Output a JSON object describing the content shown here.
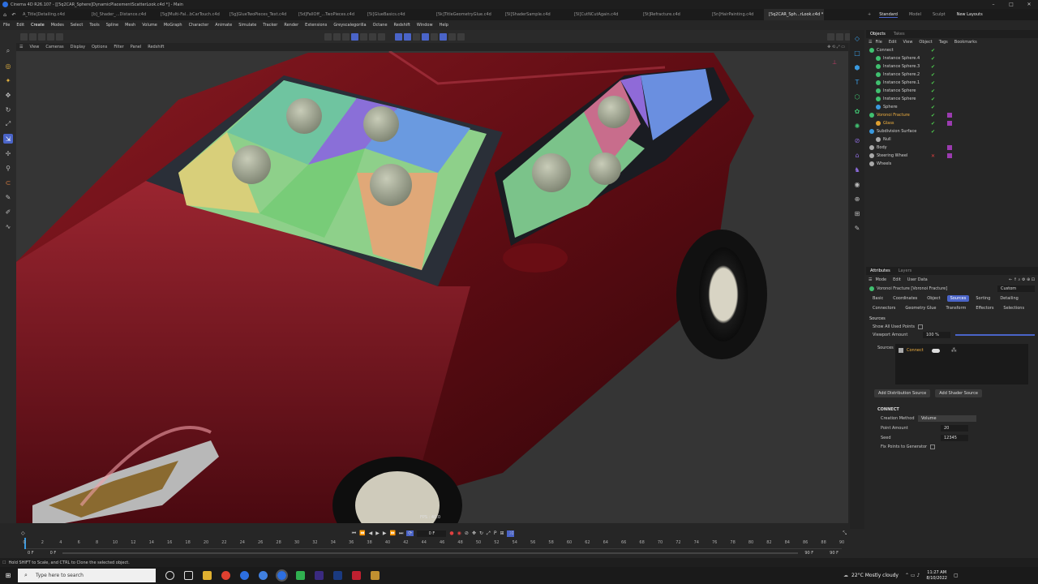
{
  "window": {
    "title": "Cinema 4D R26.107 - [[5q2CAR_Sphere]DynamicPlacementScatterLook.c4d *] - Main",
    "controls": [
      "–",
      "□",
      "✕"
    ]
  },
  "doc_tabs": [
    "A_Title]Detailing.c4d",
    "[b]_Shader_...Distance.c4d",
    "[5g]Multi-Fal...bCarTouch.c4d",
    "[5g]GlueTwoPieces_Text.c4d",
    "[5d]FallOff_...TwoPieces.c4d",
    "[5i]GlueBasics.c4d",
    "[5k]TitleGeometryGlue.c4d",
    "[5l]ShaderSample.c4d",
    "[5l]CutNCutAgain.c4d",
    "[5t]Refracture.c4d",
    "[5n]HairPainting.c4d",
    "[5q2CAR_Sph...rLook.c4d *"
  ],
  "layouts": {
    "standard": "Standard",
    "model": "Model",
    "sculpt": "Sculpt",
    "new_layouts": "New Layouts"
  },
  "menubar": [
    "File",
    "Edit",
    "Create",
    "Modes",
    "Select",
    "Tools",
    "Spline",
    "Mesh",
    "Volume",
    "MoGraph",
    "Character",
    "Animate",
    "Simulate",
    "Tracker",
    "Render",
    "Extensions",
    "Greyscalegorilla",
    "Octane",
    "Redshift",
    "Window",
    "Help"
  ],
  "view_menu": [
    "View",
    "Cameras",
    "Display",
    "Options",
    "Filter",
    "Panel",
    "Redshift"
  ],
  "viewport": {
    "fps": "FPS : 40.0"
  },
  "objects_panel": {
    "tabs": [
      "Objects",
      "Takes"
    ],
    "menu": [
      "File",
      "Edit",
      "View",
      "Object",
      "Tags",
      "Bookmarks"
    ],
    "items": [
      "Connect",
      "Instance Sphere.4",
      "Instance Sphere.3",
      "Instance Sphere.2",
      "Instance Sphere.1",
      "Instance Sphere",
      "Instance Sphere",
      "Sphere",
      "Voronoi Fracture",
      "Glass",
      "Subdivision Surface",
      "Null",
      "Body",
      "Steering Wheel",
      "Wheels"
    ]
  },
  "attributes_panel": {
    "tabs": [
      "Attributes",
      "Layers"
    ],
    "menu": [
      "Mode",
      "Edit",
      "User Data"
    ],
    "object_title": "Voronoi Fracture [Voronoi Fracture]",
    "preset": "Custom",
    "subtabs_row1": [
      "Basic",
      "Coordinates",
      "Object",
      "Sources",
      "Sorting",
      "Detailing"
    ],
    "subtabs_row2": [
      "Connectors",
      "Geometry Glue",
      "Transform",
      "Effectors",
      "Selections"
    ],
    "active_tab": "Sources",
    "section": "Sources",
    "show_all_used_points": "Show All Used Points",
    "viewport_amount_label": "Viewport Amount",
    "viewport_amount_value": "100 %",
    "viewport_amount_level": 1.0,
    "sources_label": "Sources",
    "source_item": "Connect",
    "add_distribution_source": "Add Distribution Source",
    "add_shader_source": "Add Shader Source",
    "connect_section": "CONNECT",
    "creation_method_label": "Creation Method",
    "creation_method_value": "Volume",
    "point_amount_label": "Point Amount",
    "point_amount_value": "20",
    "seed_label": "Seed",
    "seed_value": "12345",
    "fix_points_label": "Fix Points to Generator"
  },
  "timeline": {
    "current_frame": "0 F",
    "ticks": [
      "0",
      "2",
      "4",
      "6",
      "8",
      "10",
      "12",
      "14",
      "16",
      "18",
      "20",
      "22",
      "24",
      "26",
      "28",
      "30",
      "32",
      "34",
      "36",
      "38",
      "40",
      "42",
      "44",
      "46",
      "48",
      "50",
      "52",
      "54",
      "56",
      "58",
      "60",
      "62",
      "64",
      "66",
      "68",
      "70",
      "72",
      "74",
      "76",
      "78",
      "80",
      "82",
      "84",
      "86",
      "88",
      "90"
    ],
    "start": "0 F",
    "start2": "0 F",
    "end": "90 F",
    "end2": "90 F"
  },
  "status": {
    "hint": "Hold SHIFT to Scale, and CTRL to Clone the selected object."
  },
  "taskbar": {
    "search_placeholder": "Type here to search",
    "weather": "22°C Mostly cloudy",
    "time": "11:27 AM",
    "date": "8/10/2022"
  },
  "colors": {
    "accent": "#4a64c8",
    "car_red": "#6a0f16",
    "check_green": "#4ecb4e"
  }
}
